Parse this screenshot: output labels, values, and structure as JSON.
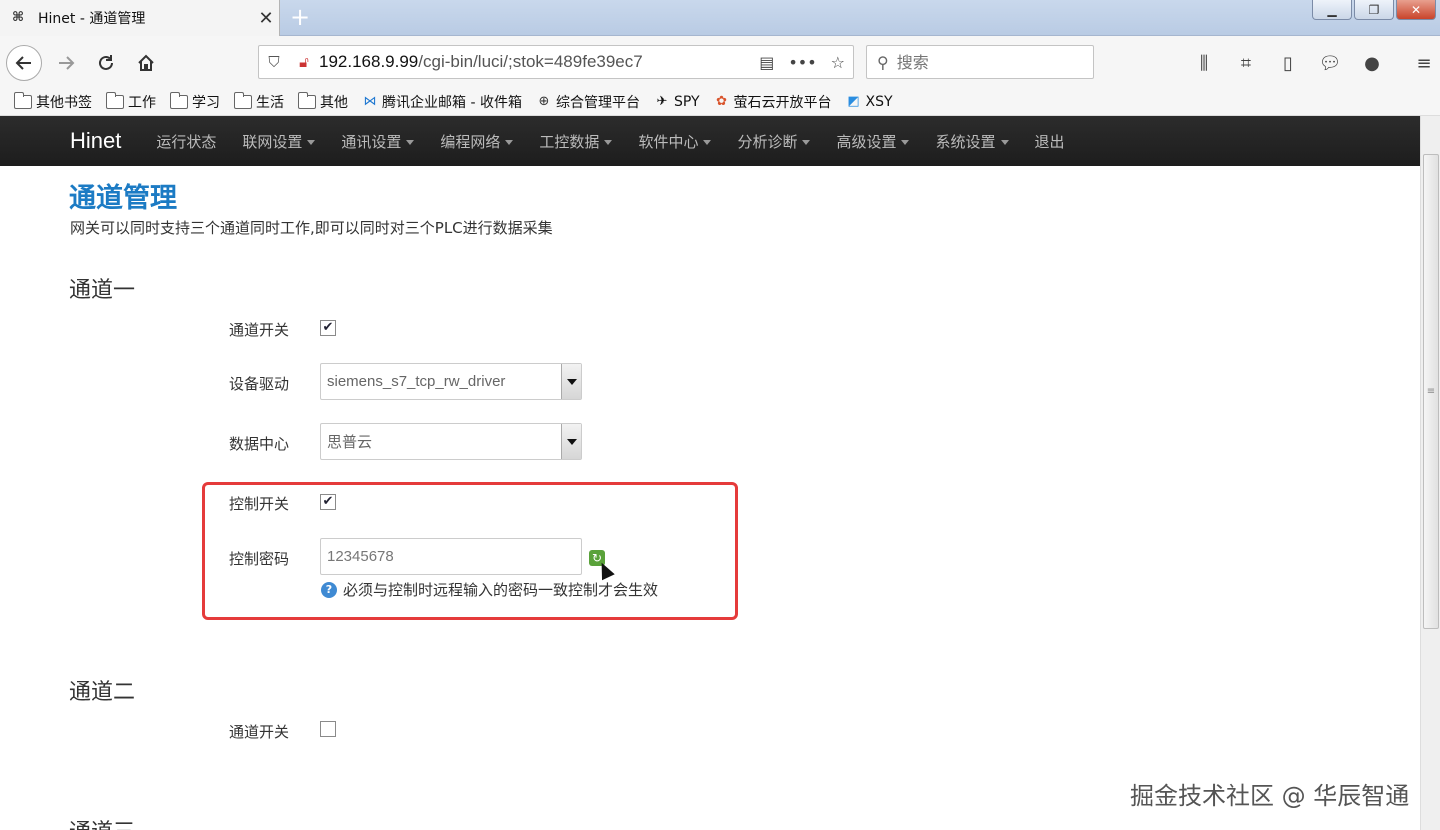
{
  "browser": {
    "tab_title": "Hinet - 通道管理",
    "tab_close": "✕",
    "new_tab": "+",
    "url_host": "192.168.9.99",
    "url_path": "/cgi-bin/luci/;stok=489fe39ec7",
    "search_placeholder": "搜索"
  },
  "bookmarks": [
    {
      "label": "其他书签",
      "icon": "folder-icon"
    },
    {
      "label": "工作",
      "icon": "folder-icon"
    },
    {
      "label": "学习",
      "icon": "folder-icon"
    },
    {
      "label": "生活",
      "icon": "folder-icon"
    },
    {
      "label": "其他",
      "icon": "folder-icon"
    },
    {
      "label": "腾讯企业邮箱 - 收件箱",
      "icon": "tencent-mail-icon"
    },
    {
      "label": "综合管理平台",
      "icon": "globe-icon"
    },
    {
      "label": "SPY",
      "icon": "spy-icon"
    },
    {
      "label": "萤石云开放平台",
      "icon": "ezviz-icon"
    },
    {
      "label": "XSY",
      "icon": "xsy-icon"
    }
  ],
  "site": {
    "brand": "Hinet",
    "menu": [
      {
        "label": "运行状态",
        "dropdown": false
      },
      {
        "label": "联网设置",
        "dropdown": true
      },
      {
        "label": "通讯设置",
        "dropdown": true
      },
      {
        "label": "编程网络",
        "dropdown": true
      },
      {
        "label": "工控数据",
        "dropdown": true
      },
      {
        "label": "软件中心",
        "dropdown": true
      },
      {
        "label": "分析诊断",
        "dropdown": true
      },
      {
        "label": "高级设置",
        "dropdown": true
      },
      {
        "label": "系统设置",
        "dropdown": true
      },
      {
        "label": "退出",
        "dropdown": false
      }
    ]
  },
  "page": {
    "title": "通道管理",
    "description": "网关可以同时支持三个通道同时工作,即可以同时对三个PLC进行数据采集",
    "channel1": {
      "heading": "通道一",
      "enable_label": "通道开关",
      "enable_checked": true,
      "driver_label": "设备驱动",
      "driver_value": "siemens_s7_tcp_rw_driver",
      "datacenter_label": "数据中心",
      "datacenter_value": "思普云",
      "control_label": "控制开关",
      "control_checked": true,
      "password_label": "控制密码",
      "password_value": "12345678",
      "password_hint": "必须与控制时远程输入的密码一致控制才会生效"
    },
    "channel2": {
      "heading": "通道二",
      "enable_label": "通道开关",
      "enable_checked": false
    },
    "channel3": {
      "heading": "通道三"
    }
  },
  "watermark": "掘金技术社区 @ 华辰智通",
  "colors": {
    "title_blue": "#1c7bc4",
    "header_dark": "#222222",
    "highlight_red": "#e53b3b"
  }
}
